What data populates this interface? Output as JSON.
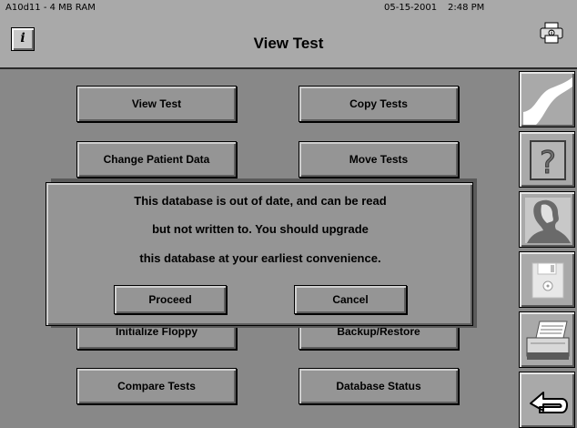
{
  "header": {
    "system_info": "A10d11 - 4 MB RAM",
    "date": "05-15-2001",
    "time": "2:48 PM",
    "info_label": "i",
    "title": "View Test"
  },
  "main": {
    "buttons": {
      "view_test": "View Test",
      "copy_tests": "Copy Tests",
      "change_patient_data": "Change Patient Data",
      "move_tests": "Move Tests",
      "initialize_floppy": "Initialize Floppy",
      "backup_restore": "Backup/Restore",
      "compare_tests": "Compare Tests",
      "database_status": "Database Status"
    }
  },
  "sidebar": {
    "icons": [
      "wave-icon",
      "help-icon",
      "patient-profile-icon",
      "floppy-disk-icon",
      "printer-icon",
      "return-arrow-icon"
    ]
  },
  "dialog": {
    "line1": "This database is out of date, and can be read",
    "line2": "but not written to. You should upgrade",
    "line3": "this database at your earliest convenience.",
    "proceed_label": "Proceed",
    "cancel_label": "Cancel"
  }
}
